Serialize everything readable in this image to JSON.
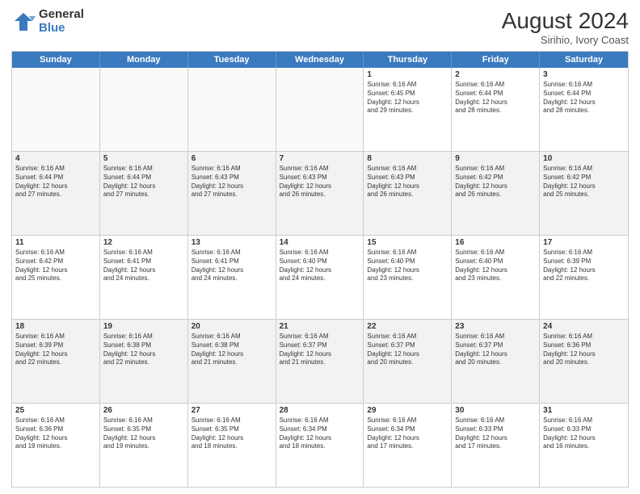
{
  "logo": {
    "general": "General",
    "blue": "Blue"
  },
  "header": {
    "title": "August 2024",
    "subtitle": "Sirihio, Ivory Coast"
  },
  "weekdays": [
    "Sunday",
    "Monday",
    "Tuesday",
    "Wednesday",
    "Thursday",
    "Friday",
    "Saturday"
  ],
  "weeks": [
    [
      {
        "day": "",
        "info": "",
        "empty": true
      },
      {
        "day": "",
        "info": "",
        "empty": true
      },
      {
        "day": "",
        "info": "",
        "empty": true
      },
      {
        "day": "",
        "info": "",
        "empty": true
      },
      {
        "day": "1",
        "info": "Sunrise: 6:16 AM\nSunset: 6:45 PM\nDaylight: 12 hours\nand 29 minutes.",
        "empty": false
      },
      {
        "day": "2",
        "info": "Sunrise: 6:16 AM\nSunset: 6:44 PM\nDaylight: 12 hours\nand 28 minutes.",
        "empty": false
      },
      {
        "day": "3",
        "info": "Sunrise: 6:16 AM\nSunset: 6:44 PM\nDaylight: 12 hours\nand 28 minutes.",
        "empty": false
      }
    ],
    [
      {
        "day": "4",
        "info": "Sunrise: 6:16 AM\nSunset: 6:44 PM\nDaylight: 12 hours\nand 27 minutes.",
        "empty": false
      },
      {
        "day": "5",
        "info": "Sunrise: 6:16 AM\nSunset: 6:44 PM\nDaylight: 12 hours\nand 27 minutes.",
        "empty": false
      },
      {
        "day": "6",
        "info": "Sunrise: 6:16 AM\nSunset: 6:43 PM\nDaylight: 12 hours\nand 27 minutes.",
        "empty": false
      },
      {
        "day": "7",
        "info": "Sunrise: 6:16 AM\nSunset: 6:43 PM\nDaylight: 12 hours\nand 26 minutes.",
        "empty": false
      },
      {
        "day": "8",
        "info": "Sunrise: 6:16 AM\nSunset: 6:43 PM\nDaylight: 12 hours\nand 26 minutes.",
        "empty": false
      },
      {
        "day": "9",
        "info": "Sunrise: 6:16 AM\nSunset: 6:42 PM\nDaylight: 12 hours\nand 26 minutes.",
        "empty": false
      },
      {
        "day": "10",
        "info": "Sunrise: 6:16 AM\nSunset: 6:42 PM\nDaylight: 12 hours\nand 25 minutes.",
        "empty": false
      }
    ],
    [
      {
        "day": "11",
        "info": "Sunrise: 6:16 AM\nSunset: 6:42 PM\nDaylight: 12 hours\nand 25 minutes.",
        "empty": false
      },
      {
        "day": "12",
        "info": "Sunrise: 6:16 AM\nSunset: 6:41 PM\nDaylight: 12 hours\nand 24 minutes.",
        "empty": false
      },
      {
        "day": "13",
        "info": "Sunrise: 6:16 AM\nSunset: 6:41 PM\nDaylight: 12 hours\nand 24 minutes.",
        "empty": false
      },
      {
        "day": "14",
        "info": "Sunrise: 6:16 AM\nSunset: 6:40 PM\nDaylight: 12 hours\nand 24 minutes.",
        "empty": false
      },
      {
        "day": "15",
        "info": "Sunrise: 6:16 AM\nSunset: 6:40 PM\nDaylight: 12 hours\nand 23 minutes.",
        "empty": false
      },
      {
        "day": "16",
        "info": "Sunrise: 6:16 AM\nSunset: 6:40 PM\nDaylight: 12 hours\nand 23 minutes.",
        "empty": false
      },
      {
        "day": "17",
        "info": "Sunrise: 6:16 AM\nSunset: 6:39 PM\nDaylight: 12 hours\nand 22 minutes.",
        "empty": false
      }
    ],
    [
      {
        "day": "18",
        "info": "Sunrise: 6:16 AM\nSunset: 6:39 PM\nDaylight: 12 hours\nand 22 minutes.",
        "empty": false
      },
      {
        "day": "19",
        "info": "Sunrise: 6:16 AM\nSunset: 6:38 PM\nDaylight: 12 hours\nand 22 minutes.",
        "empty": false
      },
      {
        "day": "20",
        "info": "Sunrise: 6:16 AM\nSunset: 6:38 PM\nDaylight: 12 hours\nand 21 minutes.",
        "empty": false
      },
      {
        "day": "21",
        "info": "Sunrise: 6:16 AM\nSunset: 6:37 PM\nDaylight: 12 hours\nand 21 minutes.",
        "empty": false
      },
      {
        "day": "22",
        "info": "Sunrise: 6:16 AM\nSunset: 6:37 PM\nDaylight: 12 hours\nand 20 minutes.",
        "empty": false
      },
      {
        "day": "23",
        "info": "Sunrise: 6:16 AM\nSunset: 6:37 PM\nDaylight: 12 hours\nand 20 minutes.",
        "empty": false
      },
      {
        "day": "24",
        "info": "Sunrise: 6:16 AM\nSunset: 6:36 PM\nDaylight: 12 hours\nand 20 minutes.",
        "empty": false
      }
    ],
    [
      {
        "day": "25",
        "info": "Sunrise: 6:16 AM\nSunset: 6:36 PM\nDaylight: 12 hours\nand 19 minutes.",
        "empty": false
      },
      {
        "day": "26",
        "info": "Sunrise: 6:16 AM\nSunset: 6:35 PM\nDaylight: 12 hours\nand 19 minutes.",
        "empty": false
      },
      {
        "day": "27",
        "info": "Sunrise: 6:16 AM\nSunset: 6:35 PM\nDaylight: 12 hours\nand 18 minutes.",
        "empty": false
      },
      {
        "day": "28",
        "info": "Sunrise: 6:16 AM\nSunset: 6:34 PM\nDaylight: 12 hours\nand 18 minutes.",
        "empty": false
      },
      {
        "day": "29",
        "info": "Sunrise: 6:16 AM\nSunset: 6:34 PM\nDaylight: 12 hours\nand 17 minutes.",
        "empty": false
      },
      {
        "day": "30",
        "info": "Sunrise: 6:16 AM\nSunset: 6:33 PM\nDaylight: 12 hours\nand 17 minutes.",
        "empty": false
      },
      {
        "day": "31",
        "info": "Sunrise: 6:16 AM\nSunset: 6:33 PM\nDaylight: 12 hours\nand 16 minutes.",
        "empty": false
      }
    ]
  ]
}
